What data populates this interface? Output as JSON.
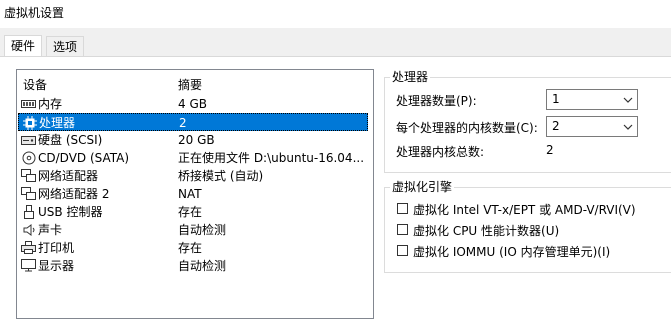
{
  "window": {
    "title": "虚拟机设置"
  },
  "tabs": [
    {
      "label": "硬件"
    },
    {
      "label": "选项"
    }
  ],
  "device_list": {
    "headers": {
      "device": "设备",
      "summary": "摘要"
    },
    "rows": [
      {
        "icon": "memory-icon",
        "name": "内存",
        "summary": "4 GB"
      },
      {
        "icon": "cpu-icon",
        "name": "处理器",
        "summary": "2"
      },
      {
        "icon": "hard-disk-icon",
        "name": "硬盘 (SCSI)",
        "summary": "20 GB"
      },
      {
        "icon": "cd-dvd-icon",
        "name": "CD/DVD (SATA)",
        "summary": "正在使用文件 D:\\ubuntu-16.04..."
      },
      {
        "icon": "network-adapter-icon",
        "name": "网络适配器",
        "summary": "桥接模式 (自动)"
      },
      {
        "icon": "network-adapter-icon",
        "name": "网络适配器 2",
        "summary": "NAT"
      },
      {
        "icon": "usb-controller-icon",
        "name": "USB 控制器",
        "summary": "存在"
      },
      {
        "icon": "sound-card-icon",
        "name": "声卡",
        "summary": "自动检测"
      },
      {
        "icon": "printer-icon",
        "name": "打印机",
        "summary": "存在"
      },
      {
        "icon": "display-icon",
        "name": "显示器",
        "summary": "自动检测"
      }
    ],
    "selected_index": 1
  },
  "processors": {
    "group_title": "处理器",
    "count_label": "处理器数量(P):",
    "count_value": "1",
    "cores_label": "每个处理器的内核数量(C):",
    "cores_value": "2",
    "total_label": "处理器内核总数:",
    "total_value": "2"
  },
  "virtualization": {
    "group_title": "虚拟化引擎",
    "options": [
      {
        "label": "虚拟化 Intel VT-x/EPT 或 AMD-V/RVI(V)",
        "checked": false
      },
      {
        "label": "虚拟化 CPU 性能计数器(U)",
        "checked": false
      },
      {
        "label": "虚拟化 IOMMU (IO 内存管理单元)(I)",
        "checked": false
      }
    ]
  },
  "colors": {
    "selection": "#0078d7",
    "border": "#828790"
  }
}
